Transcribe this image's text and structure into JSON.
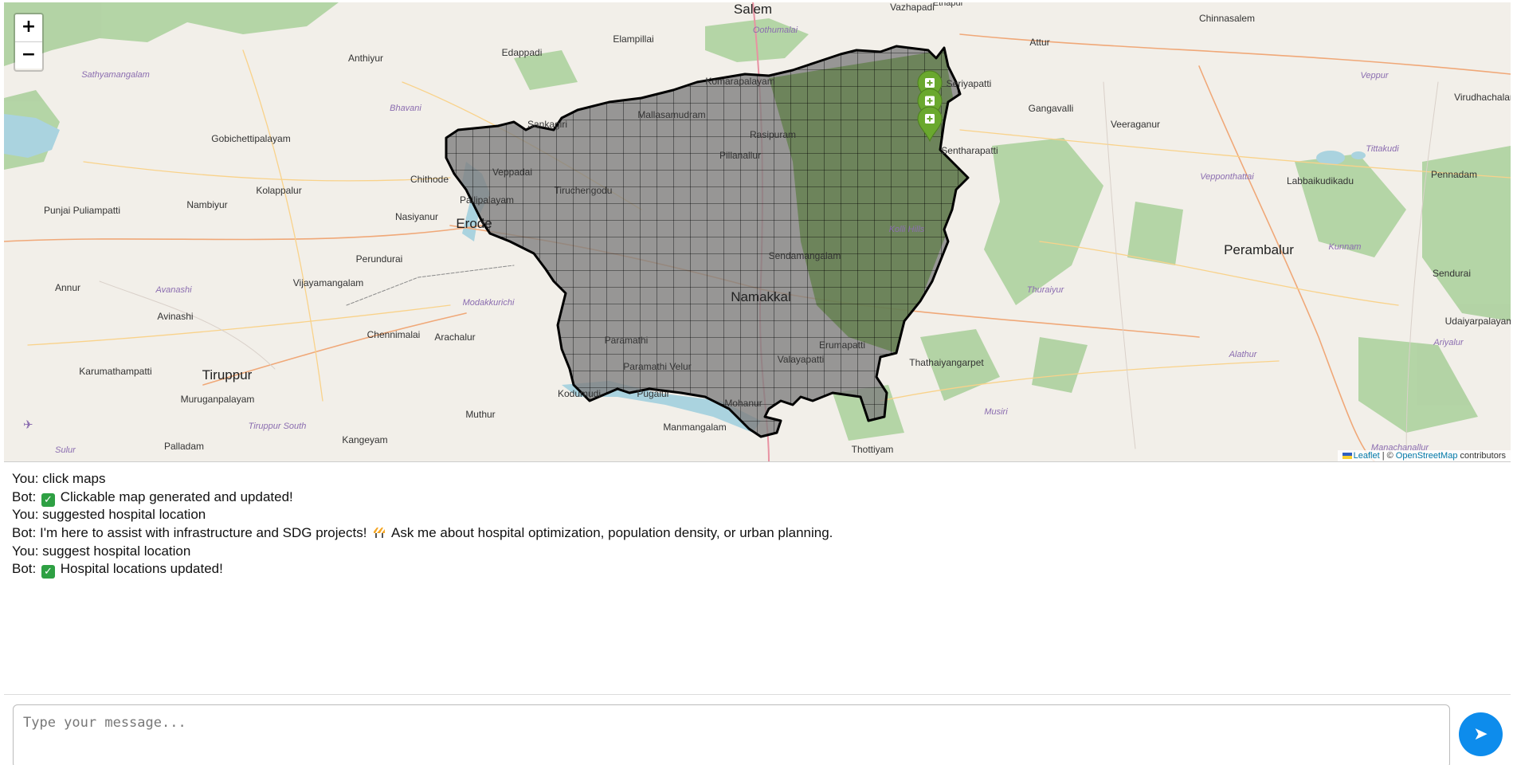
{
  "map": {
    "zoom_in_label": "+",
    "zoom_out_label": "−",
    "attribution": {
      "leaflet": "Leaflet",
      "separator": "| ©",
      "osm": "OpenStreetMap",
      "suffix": "contributors"
    },
    "district_name": "Namakkal",
    "region_fill_color": "#808080",
    "forest_color": "#7a9a5a",
    "marker_color": "#6aa82e",
    "marker_count": 3,
    "place_labels": [
      "Salem",
      "Vazhapadi",
      "Ethapur",
      "Chinnasalem",
      "Edappadi",
      "Elampillai",
      "Oothumalai",
      "Anthiyur",
      "Attur",
      "Veppur",
      "Sathyamangalam",
      "Virudhachalam",
      "Bhavani",
      "Sankagiri",
      "Mallasamudram",
      "Komarapalayam",
      "Rasipuram",
      "Seriyapatti",
      "Gangavalli",
      "Veeraganur",
      "Gobichettipalayam",
      "Pillanallur",
      "Sentharapatti",
      "Tittakudi",
      "Chithode",
      "Veppadai",
      "Tiruchengodu",
      "Vepponthattai",
      "Labbaikudikadu",
      "Pennadam",
      "Punjai Puliampatti",
      "Nambiyur",
      "Kolappalur",
      "Pallipalayam",
      "Nasiyanur",
      "Erode",
      "Kolli Hills",
      "Perundurai",
      "Sendamangalam",
      "Perambalur",
      "Kunnam",
      "Sendurai",
      "Vijayamangalam",
      "Annur",
      "Avanashi",
      "Modakkurichi",
      "Namakkal",
      "Thuraiyur",
      "Avinashi",
      "Paramathi",
      "Chennimalai",
      "Arachalur",
      "Erumapatti",
      "Udaiyarpalayam",
      "Ariyalur",
      "Karumathampatti",
      "Tiruppur",
      "Thathaiyangarpet",
      "Paramathi Velur",
      "Valayapatti",
      "Alathur",
      "Muruganpalayam",
      "Kodumudi",
      "Pugalur",
      "Mohanur",
      "Musiri",
      "Tiruppur South",
      "Muthur",
      "Manmangalam",
      "Thottiyam",
      "Sulur",
      "Palladam",
      "Kangeyam",
      "Manachanallur"
    ]
  },
  "chat": {
    "messages": [
      {
        "speaker": "You:",
        "text": "click maps",
        "icon": ""
      },
      {
        "speaker": "Bot:",
        "text": "Clickable map generated and updated!",
        "icon": "check-icon"
      },
      {
        "speaker": "You:",
        "text": "suggested hospital location",
        "icon": ""
      },
      {
        "speaker": "Bot:",
        "text": "I'm here to assist with infrastructure and SDG projects!",
        "icon": "construction-icon",
        "text_after_icon": "Ask me about hospital optimization, population density, or urban planning."
      },
      {
        "speaker": "You:",
        "text": "suggest hospital location",
        "icon": ""
      },
      {
        "speaker": "Bot:",
        "text": "Hospital locations updated!",
        "icon": "check-icon"
      }
    ]
  },
  "input": {
    "placeholder": "Type your message...",
    "value": ""
  },
  "send_button": {
    "label": "➤",
    "color": "#0d8cec"
  }
}
